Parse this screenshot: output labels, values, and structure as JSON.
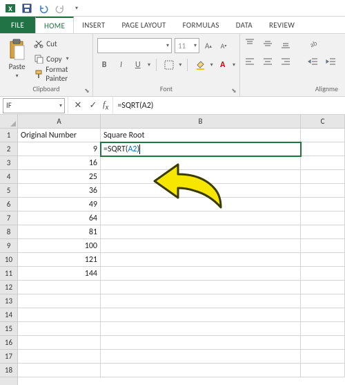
{
  "qat": {
    "tooltip_save": "Save",
    "tooltip_undo": "Undo",
    "tooltip_redo": "Redo"
  },
  "tabs": {
    "file": "FILE",
    "home": "HOME",
    "insert": "INSERT",
    "page_layout": "PAGE LAYOUT",
    "formulas": "FORMULAS",
    "data": "DATA",
    "review": "REVIEW"
  },
  "ribbon": {
    "clipboard": {
      "paste": "Paste",
      "cut": "Cut",
      "copy": "Copy",
      "format_painter": "Format Painter",
      "label": "Clipboard"
    },
    "font": {
      "name_placeholder": "",
      "size": "11",
      "bold": "B",
      "italic": "I",
      "underline": "U",
      "label": "Font"
    },
    "alignment": {
      "label": "Alignment",
      "truncated": "Alignme"
    }
  },
  "namebox": {
    "value": "IF"
  },
  "formula_bar": {
    "value": "=SQRT(A2)"
  },
  "columns": [
    "A",
    "B",
    "C"
  ],
  "sheet": {
    "headers": {
      "a": "Original Number",
      "b": "Square Root"
    },
    "editing_cell": {
      "prefix": "=SQRT(",
      "ref": "A2",
      "suffix": ")"
    },
    "col_a_values": [
      "9",
      "16",
      "25",
      "36",
      "49",
      "64",
      "81",
      "100",
      "121",
      "144"
    ],
    "row_count_visible": 18
  },
  "chart_data": {
    "type": "table",
    "title": "",
    "columns": [
      "Original Number",
      "Square Root"
    ],
    "rows": [
      [
        9,
        "=SQRT(A2)"
      ],
      [
        16,
        ""
      ],
      [
        25,
        ""
      ],
      [
        36,
        ""
      ],
      [
        49,
        ""
      ],
      [
        64,
        ""
      ],
      [
        81,
        ""
      ],
      [
        100,
        ""
      ],
      [
        121,
        ""
      ],
      [
        144,
        ""
      ]
    ]
  },
  "colors": {
    "excel_green": "#217346",
    "arrow_fill": "#f7e600",
    "arrow_stroke": "#3b3b00",
    "cell_ref": "#0070c0"
  }
}
